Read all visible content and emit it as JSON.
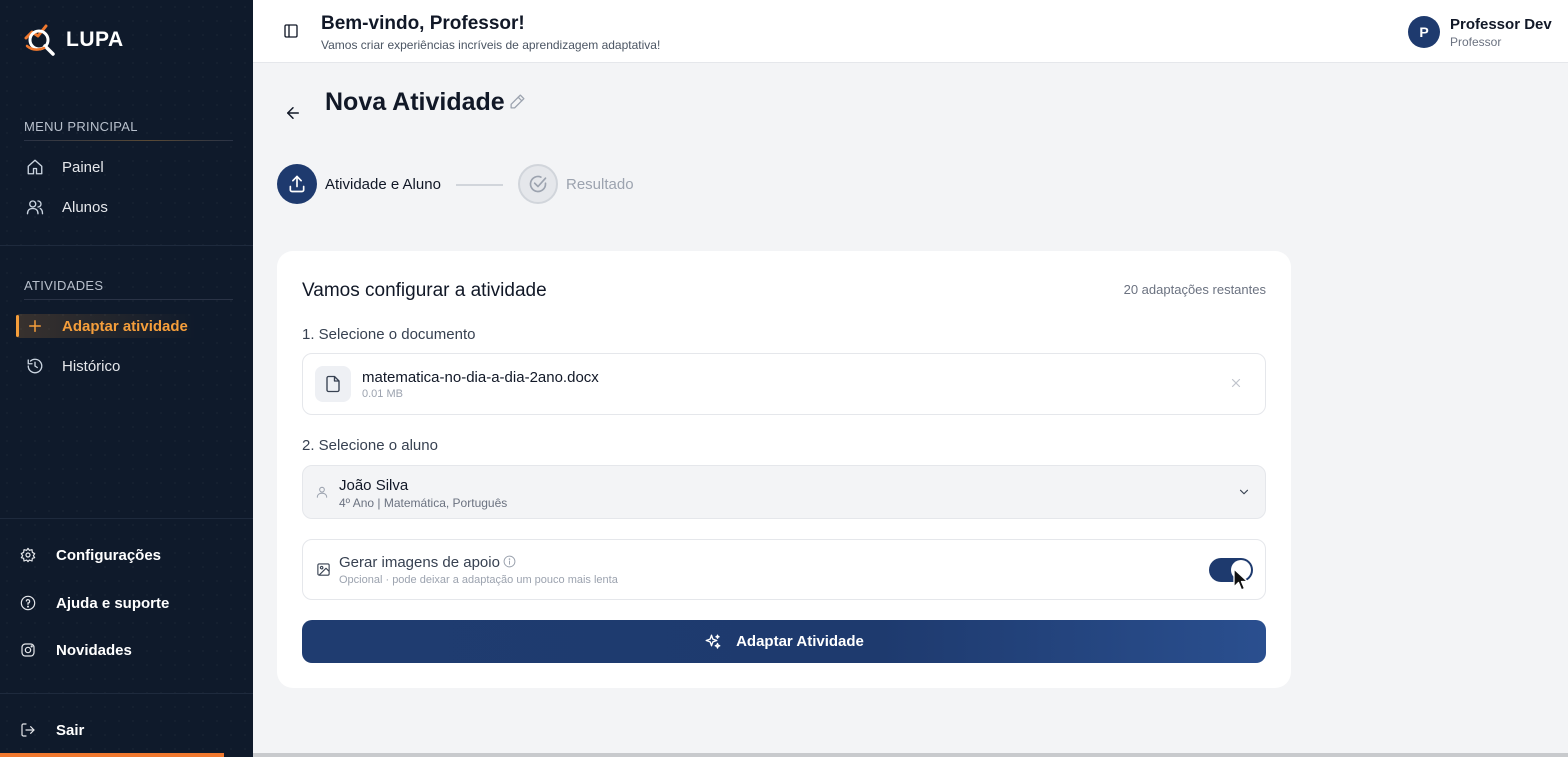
{
  "app": {
    "name": "LUPA"
  },
  "sidebar": {
    "main_section": "MENU PRINCIPAL",
    "main_items": [
      {
        "label": "Painel",
        "icon": "home-icon"
      },
      {
        "label": "Alunos",
        "icon": "users-icon"
      }
    ],
    "activities_section": "ATIVIDADES",
    "activity_items": [
      {
        "label": "Adaptar atividade",
        "icon": "plus-icon",
        "active": true
      },
      {
        "label": "Histórico",
        "icon": "history-icon"
      }
    ],
    "bottom_items": [
      {
        "label": "Configurações",
        "icon": "gear-icon"
      },
      {
        "label": "Ajuda e suporte",
        "icon": "help-icon"
      },
      {
        "label": "Novidades",
        "icon": "instagram-icon"
      }
    ],
    "logout": "Sair",
    "accent_color": "#f59e3b"
  },
  "header": {
    "welcome": "Bem-vindo, Professor!",
    "subtitle": "Vamos criar experiências incríveis de aprendizagem adaptativa!",
    "user": {
      "initial": "P",
      "name": "Professor Dev",
      "role": "Professor"
    }
  },
  "page": {
    "title": "Nova Atividade",
    "steps": [
      {
        "label": "Atividade e Aluno",
        "state": "current"
      },
      {
        "label": "Resultado",
        "state": "pending"
      }
    ]
  },
  "card": {
    "title": "Vamos configurar a atividade",
    "remaining": "20 adaptações restantes",
    "document_label": "1. Selecione o documento",
    "file": {
      "name": "matematica-no-dia-a-dia-2ano.docx",
      "size": "0.01 MB"
    },
    "student_label": "2. Selecione o aluno",
    "student": {
      "name": "João Silva",
      "meta": "4º Ano | Matemática, Português"
    },
    "images": {
      "label": "Gerar imagens de apoio",
      "sub": "Opcional · pode deixar a adaptação um pouco mais lenta",
      "enabled": true
    },
    "submit": "Adaptar Atividade"
  },
  "colors": {
    "primary": "#1e3a6e",
    "sidebar_bg": "#0f1a2b",
    "accent": "#f59e3b"
  }
}
